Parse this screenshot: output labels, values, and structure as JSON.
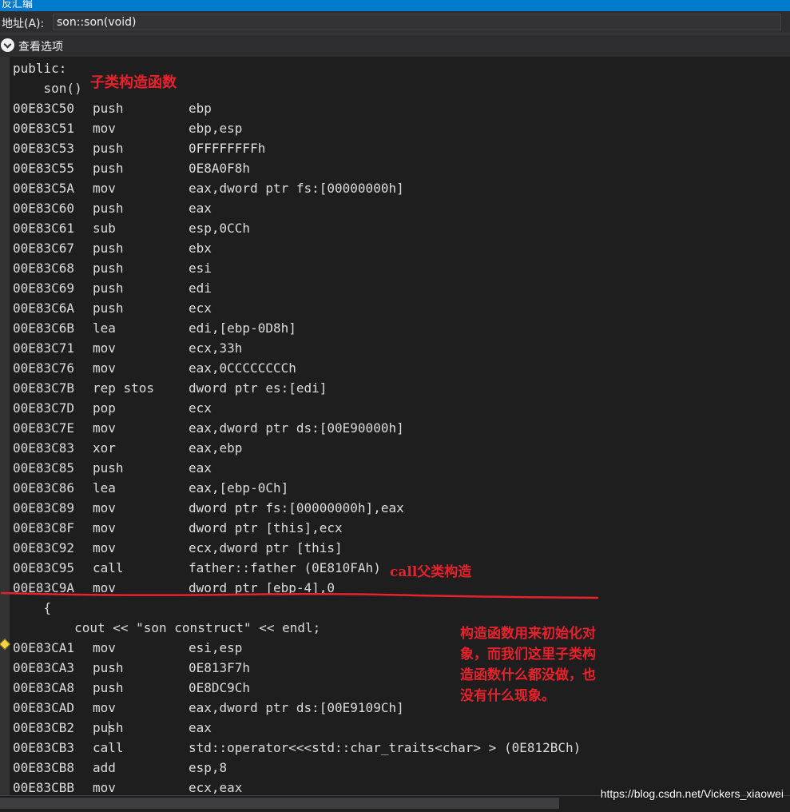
{
  "window": {
    "title": "反汇编"
  },
  "address_bar": {
    "label": "地址(A):",
    "value": "son::son(void)"
  },
  "view_options": {
    "label": "查看选项"
  },
  "source_lines": {
    "public": "public:",
    "ctor": "    son()",
    "brace": "    {",
    "cout": "        cout << \"son construct\" << endl;"
  },
  "disasm_top": [
    {
      "addr": "00E83C50",
      "mnem": "push",
      "oper": "ebp"
    },
    {
      "addr": "00E83C51",
      "mnem": "mov",
      "oper": "ebp,esp"
    },
    {
      "addr": "00E83C53",
      "mnem": "push",
      "oper": "0FFFFFFFFh"
    },
    {
      "addr": "00E83C55",
      "mnem": "push",
      "oper": "0E8A0F8h"
    },
    {
      "addr": "00E83C5A",
      "mnem": "mov",
      "oper": "eax,dword ptr fs:[00000000h]"
    },
    {
      "addr": "00E83C60",
      "mnem": "push",
      "oper": "eax"
    },
    {
      "addr": "00E83C61",
      "mnem": "sub",
      "oper": "esp,0CCh"
    },
    {
      "addr": "00E83C67",
      "mnem": "push",
      "oper": "ebx"
    },
    {
      "addr": "00E83C68",
      "mnem": "push",
      "oper": "esi"
    },
    {
      "addr": "00E83C69",
      "mnem": "push",
      "oper": "edi"
    },
    {
      "addr": "00E83C6A",
      "mnem": "push",
      "oper": "ecx"
    },
    {
      "addr": "00E83C6B",
      "mnem": "lea",
      "oper": "edi,[ebp-0D8h]"
    },
    {
      "addr": "00E83C71",
      "mnem": "mov",
      "oper": "ecx,33h"
    },
    {
      "addr": "00E83C76",
      "mnem": "mov",
      "oper": "eax,0CCCCCCCCh"
    },
    {
      "addr": "00E83C7B",
      "mnem": "rep stos",
      "oper": "dword ptr es:[edi]"
    },
    {
      "addr": "00E83C7D",
      "mnem": "pop",
      "oper": "ecx"
    },
    {
      "addr": "00E83C7E",
      "mnem": "mov",
      "oper": "eax,dword ptr ds:[00E90000h]"
    },
    {
      "addr": "00E83C83",
      "mnem": "xor",
      "oper": "eax,ebp"
    },
    {
      "addr": "00E83C85",
      "mnem": "push",
      "oper": "eax"
    },
    {
      "addr": "00E83C86",
      "mnem": "lea",
      "oper": "eax,[ebp-0Ch]"
    },
    {
      "addr": "00E83C89",
      "mnem": "mov",
      "oper": "dword ptr fs:[00000000h],eax"
    },
    {
      "addr": "00E83C8F",
      "mnem": "mov",
      "oper": "dword ptr [this],ecx"
    },
    {
      "addr": "00E83C92",
      "mnem": "mov",
      "oper": "ecx,dword ptr [this]"
    },
    {
      "addr": "00E83C95",
      "mnem": "call",
      "oper": "father::father (0E810FAh)"
    },
    {
      "addr": "00E83C9A",
      "mnem": "mov",
      "oper": "dword ptr [ebp-4],0"
    }
  ],
  "disasm_bottom": [
    {
      "addr": "00E83CA1",
      "mnem": "mov",
      "oper": "esi,esp"
    },
    {
      "addr": "00E83CA3",
      "mnem": "push",
      "oper": "0E813F7h"
    },
    {
      "addr": "00E83CA8",
      "mnem": "push",
      "oper": "0E8DC9Ch"
    },
    {
      "addr": "00E83CAD",
      "mnem": "mov",
      "oper": "eax,dword ptr ds:[00E9109Ch]"
    },
    {
      "addr": "00E83CB2",
      "mnem": "push",
      "oper": "eax"
    },
    {
      "addr": "00E83CB3",
      "mnem": "call",
      "oper": "std::operator<<<std::char_traits<char> > (0E812BCh)"
    },
    {
      "addr": "00E83CB8",
      "mnem": "add",
      "oper": "esp,8"
    },
    {
      "addr": "00E83CBB",
      "mnem": "mov",
      "oper": "ecx,eax"
    }
  ],
  "annotations": {
    "ctor_note": "子类构造函数",
    "call_note": "call父类构造",
    "explain_lines": [
      "构造函数用来初始化对",
      "象，而我们这里子类构",
      "造函数什么都没做，也",
      "没有什么现象。"
    ]
  },
  "watermark": "https://blog.csdn.net/Vickers_xiaowei",
  "colors": {
    "annotation": "#e8222d",
    "text": "#dcdcdc",
    "background": "#1e1e1e",
    "accent": "#007acc"
  }
}
